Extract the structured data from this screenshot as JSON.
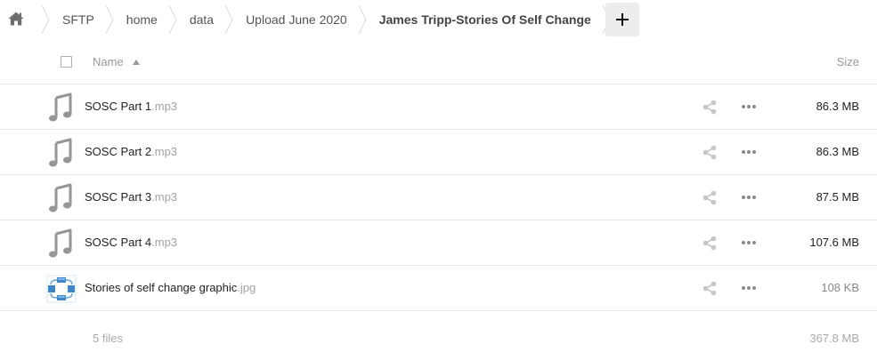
{
  "breadcrumb": {
    "items": [
      {
        "label": "SFTP"
      },
      {
        "label": "home"
      },
      {
        "label": "data"
      },
      {
        "label": "Upload June 2020"
      },
      {
        "label": "James Tripp-Stories Of Self Change"
      }
    ],
    "home_icon": "home-icon",
    "add_icon": "plus-icon"
  },
  "table": {
    "columns": {
      "name": "Name",
      "size": "Size"
    },
    "sort": "name-ascending",
    "files": [
      {
        "base": "SOSC Part 1",
        "ext": ".mp3",
        "size": "86.3 MB",
        "icon": "audio-file-icon"
      },
      {
        "base": "SOSC Part 2",
        "ext": ".mp3",
        "size": "86.3 MB",
        "icon": "audio-file-icon"
      },
      {
        "base": "SOSC Part 3",
        "ext": ".mp3",
        "size": "87.5 MB",
        "icon": "audio-file-icon"
      },
      {
        "base": "SOSC Part 4",
        "ext": ".mp3",
        "size": "107.6 MB",
        "icon": "audio-file-icon"
      },
      {
        "base": "Stories of self change graphic",
        "ext": ".jpg",
        "size": "108 KB",
        "icon": "image-thumbnail"
      }
    ],
    "summary": {
      "count": "5 files",
      "total": "367.8 MB"
    }
  },
  "colors": {
    "text": "#222222",
    "muted": "#999999",
    "extension": "#a3a3a3",
    "icon_gray": "#969696",
    "divider": "#e6e6e6",
    "add_button_bg": "#ededed"
  }
}
